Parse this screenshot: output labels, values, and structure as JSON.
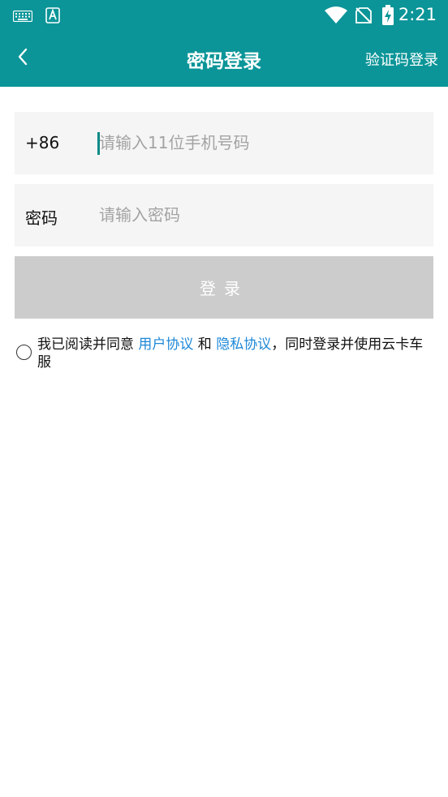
{
  "status_bar": {
    "time": "2:21",
    "icons": [
      "keyboard-icon",
      "text-app-icon",
      "wifi-icon",
      "no-sim-icon",
      "battery-charging-icon"
    ]
  },
  "header": {
    "back_icon": "chevron-left-icon",
    "title": "密码登录",
    "switch_link": "验证码登录"
  },
  "form": {
    "phone": {
      "prefix": "+86",
      "placeholder": "请输入11位手机号码",
      "value": ""
    },
    "password": {
      "label": "密码",
      "placeholder": "请输入密码",
      "value": ""
    },
    "login_button": "登录"
  },
  "agreement": {
    "checked": false,
    "prefix": "我已阅读并同意 ",
    "user_agreement": "用户协议",
    "and": " 和 ",
    "privacy_policy": "隐私协议",
    "suffix_line1": "，同时登录并使用云卡车",
    "suffix_line2": "服"
  },
  "colors": {
    "brand": "#0b9598",
    "link": "#1e88d8",
    "field_bg": "#f5f5f5",
    "button_disabled": "#cccccc"
  }
}
